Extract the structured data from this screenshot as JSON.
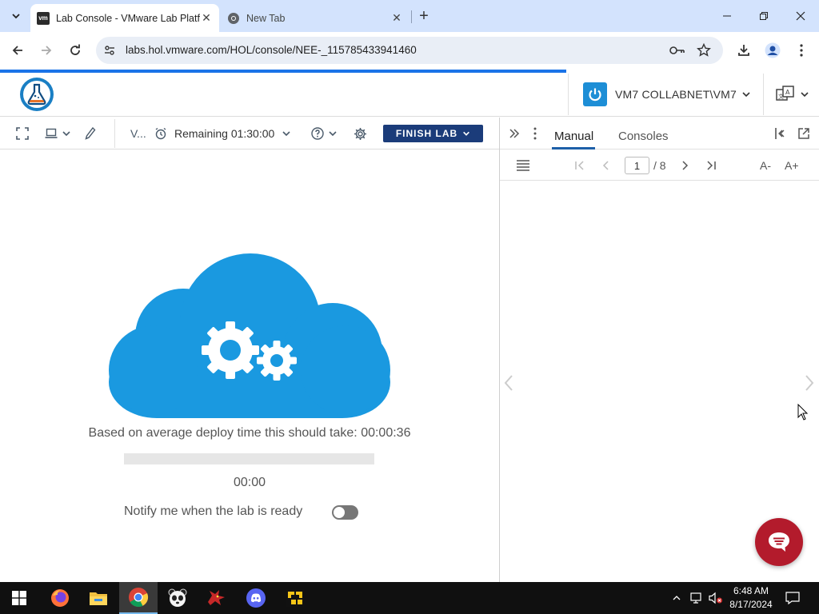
{
  "browser": {
    "tabs": [
      {
        "title": "Lab Console - VMware Lab Platf",
        "favicon": "vm-icon",
        "active": true
      },
      {
        "title": "New Tab",
        "favicon": "chrome-icon",
        "active": false
      }
    ],
    "url": "labs.hol.vmware.com/HOL/console/NEE-_115785433941460",
    "favicon_text": "vm"
  },
  "header": {
    "vm_name": "VM7 COLLABNET\\VM7"
  },
  "console_toolbar": {
    "vm_short": "V...",
    "remaining": "Remaining 01:30:00",
    "finish_label": "FINISH LAB"
  },
  "deploy": {
    "message": "Based on average deploy time this should take: 00:00:36",
    "progress": 0,
    "timer": "00:00",
    "notify_label": "Notify me when the lab is ready",
    "notify_enabled": false
  },
  "manual_panel": {
    "tabs": [
      "Manual",
      "Consoles"
    ],
    "active_tab": "Manual",
    "page": "1",
    "total": "/ 8",
    "font_decrease": "A-",
    "font_increase": "A+"
  },
  "taskbar": {
    "apps": [
      "firefox-icon",
      "file-explorer-icon",
      "chrome-icon",
      "panda-icon",
      "dragon-icon",
      "discord-icon",
      "puzzle-app-icon"
    ],
    "time": "6:48 AM",
    "date": "8/17/2024"
  },
  "colors": {
    "accent": "#1d8ed6",
    "finish_button": "#1b3c7a",
    "chat_button": "#b31b2c",
    "tabstrip": "#d3e3fd"
  }
}
